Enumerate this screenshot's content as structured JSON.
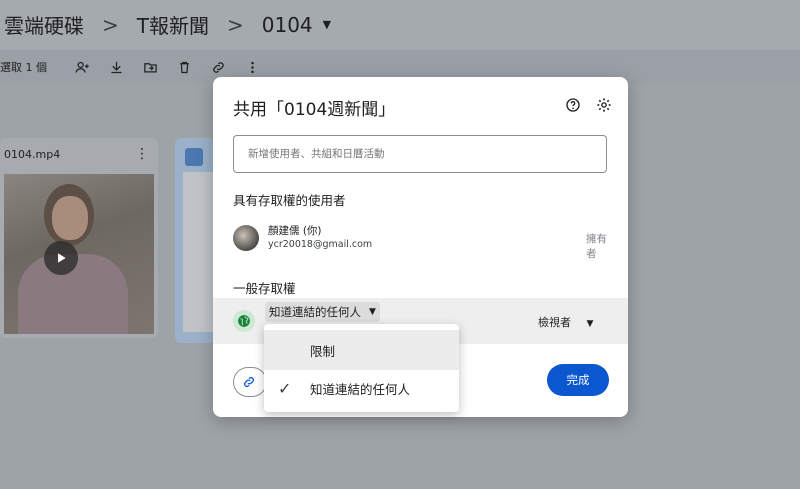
{
  "breadcrumb": {
    "items": [
      "雲端硬碟",
      "T報新聞",
      "0104"
    ],
    "separator": ">"
  },
  "toolbar": {
    "selected_text": "選取 1 個",
    "icons": [
      "add-person-icon",
      "download-icon",
      "move-to-folder-icon",
      "trash-icon",
      "link-icon",
      "more-vert-icon"
    ]
  },
  "files": {
    "video_title": "0104.mp4"
  },
  "dialog": {
    "title": "共用「0104週新聞」",
    "add_placeholder": "新增使用者、共組和日曆活動",
    "people_heading": "具有存取權的使用者",
    "user": {
      "name": "顏建儒 (你)",
      "email": "ycr20018@gmail.com",
      "role": "擁有者"
    },
    "general_heading": "一般存取權",
    "access_value": "知道連結的任何人",
    "role_value": "檢視者",
    "done_label": "完成"
  },
  "menu": {
    "options": [
      "限制",
      "知道連結的任何人"
    ],
    "selected_index": 1
  },
  "colors": {
    "primary": "#0b57d0",
    "globe_bg": "#cde8d3",
    "globe_fg": "#188038"
  }
}
